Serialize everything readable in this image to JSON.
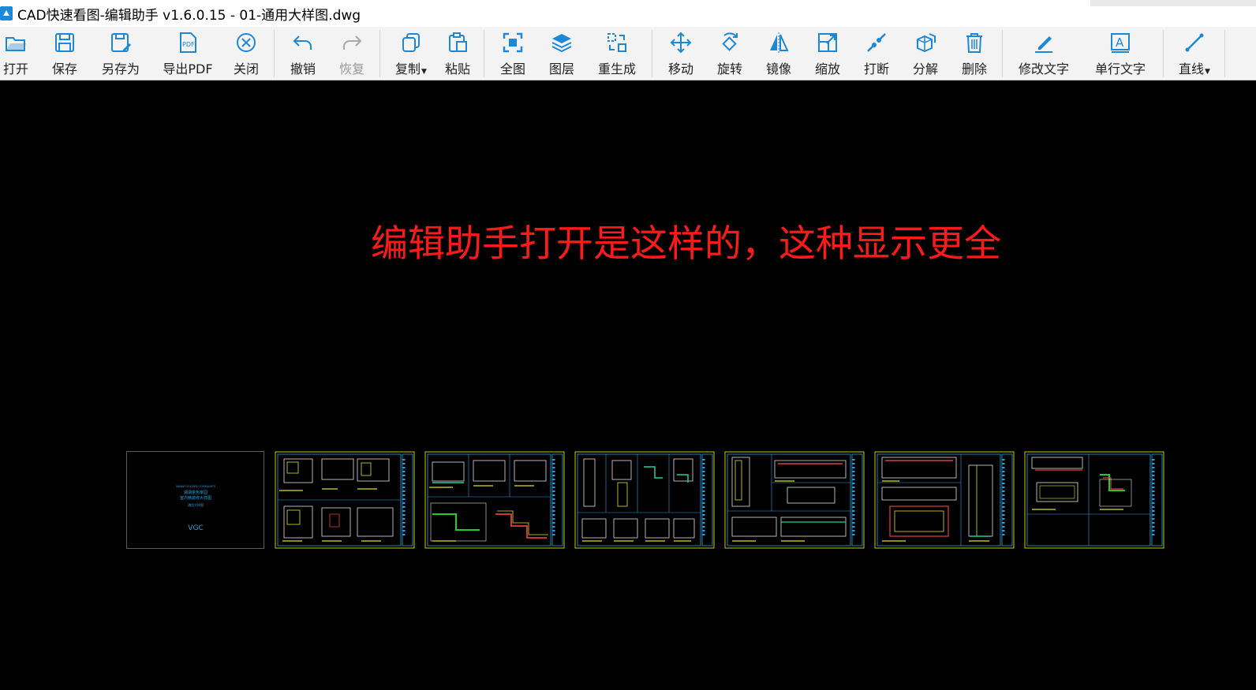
{
  "window": {
    "title": "CAD快速看图-编辑助手 v1.6.0.15 - 01-通用大样图.dwg",
    "icon": "app-logo-icon"
  },
  "toolbar": {
    "accent": "#1e88d8",
    "items": [
      {
        "id": "open",
        "label": "打开",
        "icon": "folder-open-icon"
      },
      {
        "id": "save",
        "label": "保存",
        "icon": "floppy-icon"
      },
      {
        "id": "saveas",
        "label": "另存为",
        "icon": "floppy-edit-icon"
      },
      {
        "id": "exportpdf",
        "label": "导出PDF",
        "icon": "pdf-file-icon"
      },
      {
        "id": "close",
        "label": "关闭",
        "icon": "close-circle-icon"
      },
      {
        "id": "undo",
        "label": "撤销",
        "icon": "undo-arrow-icon"
      },
      {
        "id": "redo",
        "label": "恢复",
        "icon": "redo-arrow-icon",
        "disabled": true
      },
      {
        "id": "copy",
        "label": "复制",
        "icon": "copy-icon",
        "dropdown": true
      },
      {
        "id": "paste",
        "label": "粘贴",
        "icon": "clipboard-icon"
      },
      {
        "id": "fullview",
        "label": "全图",
        "icon": "fit-view-icon"
      },
      {
        "id": "layers",
        "label": "图层",
        "icon": "layers-icon"
      },
      {
        "id": "regen",
        "label": "重生成",
        "icon": "regenerate-icon"
      },
      {
        "id": "move",
        "label": "移动",
        "icon": "move-arrows-icon"
      },
      {
        "id": "rotate",
        "label": "旋转",
        "icon": "rotate-icon"
      },
      {
        "id": "mirror",
        "label": "镜像",
        "icon": "mirror-icon"
      },
      {
        "id": "scale",
        "label": "缩放",
        "icon": "scale-icon"
      },
      {
        "id": "break",
        "label": "打断",
        "icon": "break-line-icon"
      },
      {
        "id": "explode",
        "label": "分解",
        "icon": "explode-cube-icon"
      },
      {
        "id": "delete",
        "label": "删除",
        "icon": "trash-icon"
      },
      {
        "id": "edittext",
        "label": "修改文字",
        "icon": "pen-underline-icon"
      },
      {
        "id": "singletext",
        "label": "单行文字",
        "icon": "text-box-icon"
      },
      {
        "id": "line",
        "label": "直线",
        "icon": "line-icon",
        "dropdown": true
      }
    ]
  },
  "canvas": {
    "overlay_text": "编辑助手打开是这样的，这种显示更全",
    "overlay_color": "#ff1a1a",
    "cover_sheet": {
      "line1": "VANKE GOLDEN COMMUNITY",
      "line2": "湖湖金色家园",
      "line3": "室内精装修大样图",
      "line4": "通用大样图",
      "logo": "VGC"
    },
    "sheet_count": 7
  }
}
